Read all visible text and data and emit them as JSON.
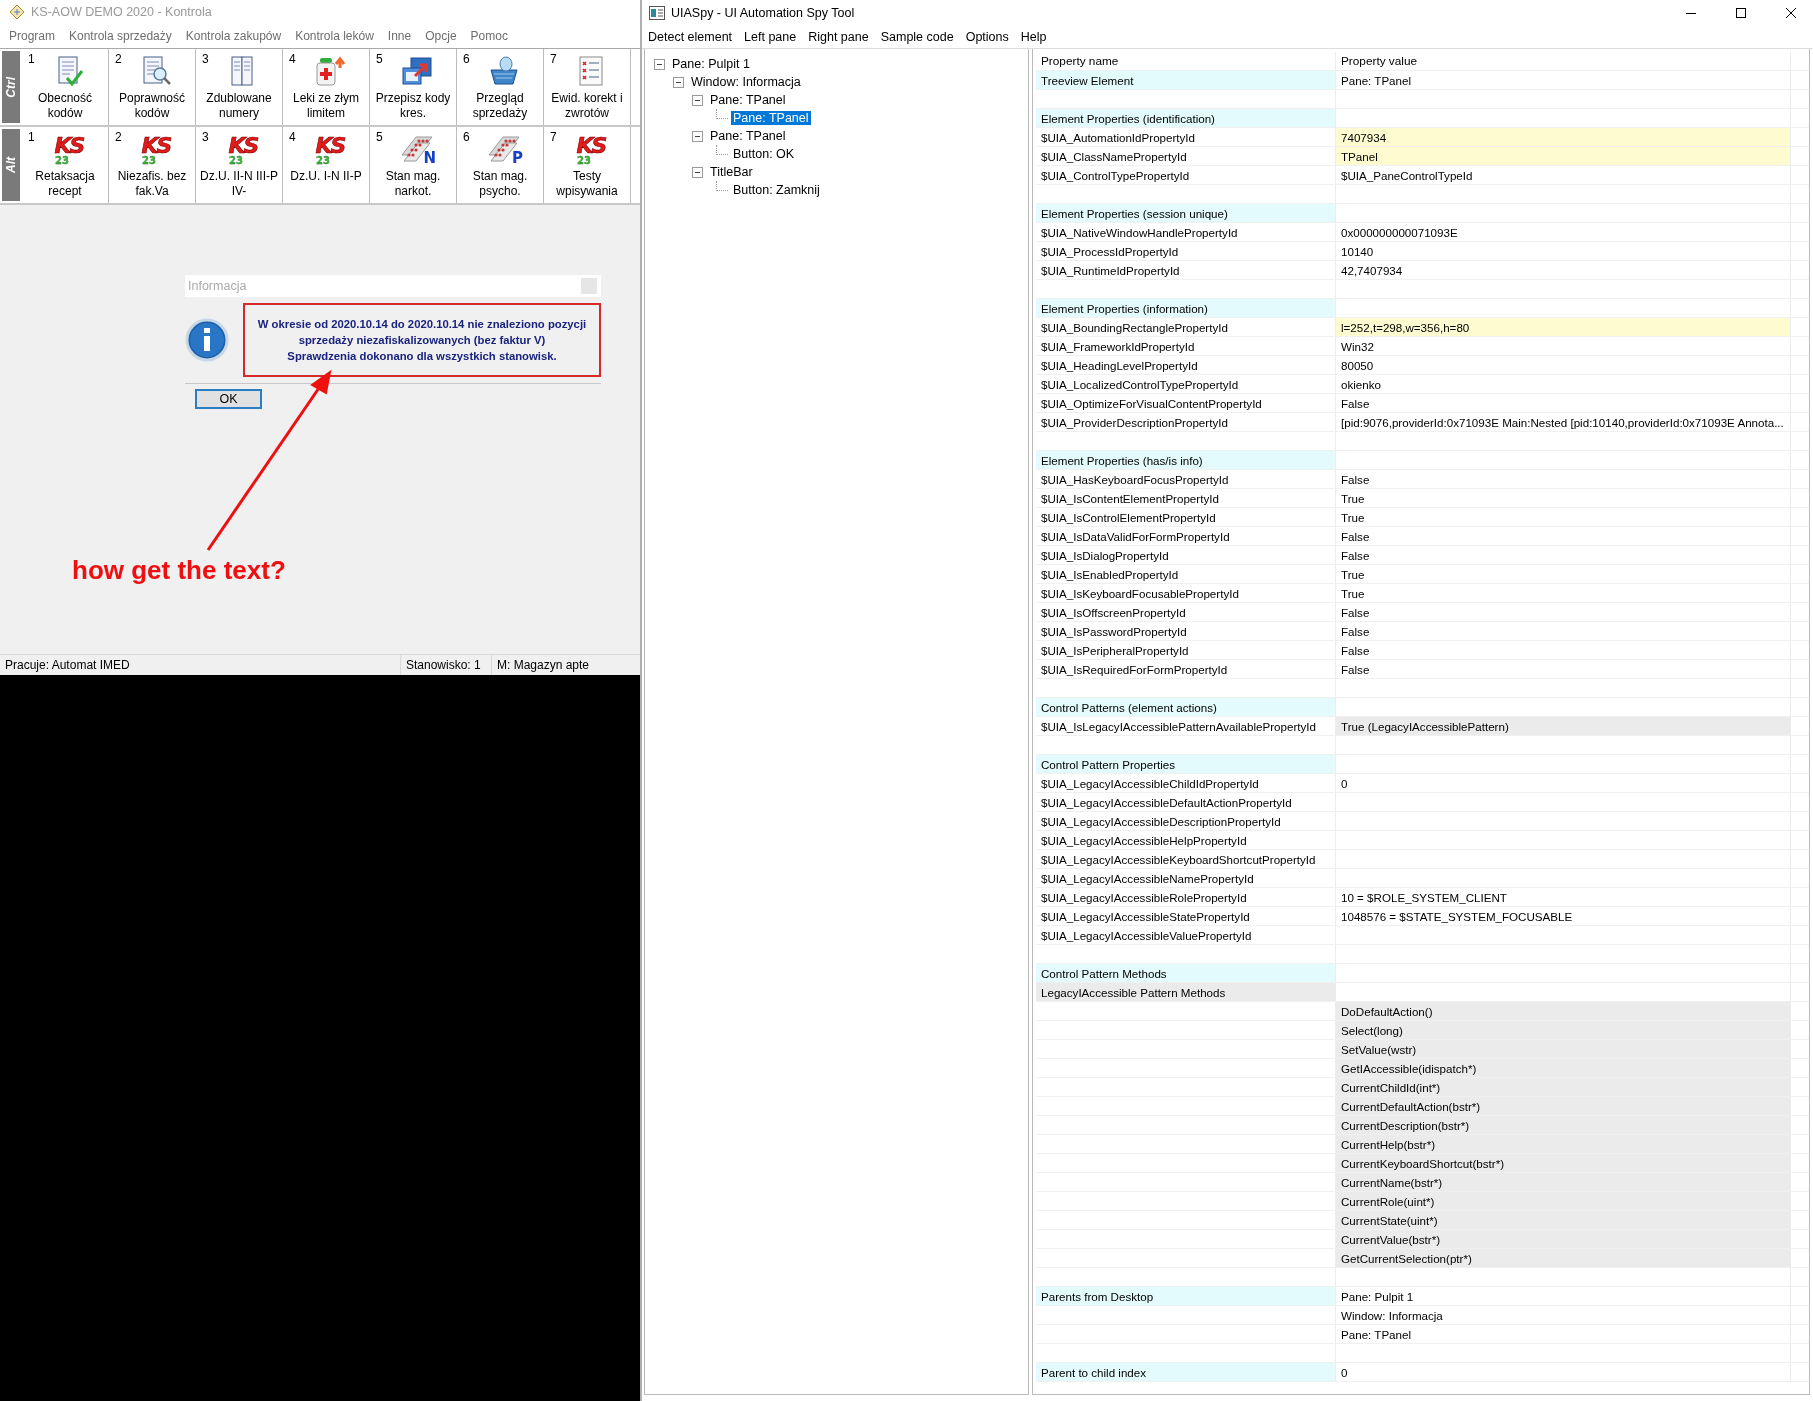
{
  "left_window": {
    "title": "KS-AOW DEMO 2020 - Kontrola",
    "menu": [
      "Program",
      "Kontrola sprzedaży",
      "Kontrola zakupów",
      "Kontrola leków",
      "Inne",
      "Opcje",
      "Pomoc"
    ],
    "toolbar_rows": [
      {
        "modifier": "Ctrl",
        "buttons": [
          {
            "number": "1",
            "label": "Obecność kodów",
            "kind": "check-doc"
          },
          {
            "number": "2",
            "label": "Poprawność kodów",
            "kind": "search-doc"
          },
          {
            "number": "3",
            "label": "Zdublowane numery",
            "kind": "double-doc"
          },
          {
            "number": "4",
            "label": "Leki ze złym limitem",
            "kind": "bottle"
          },
          {
            "number": "5",
            "label": "Przepisz kody kres.",
            "kind": "transfer"
          },
          {
            "number": "6",
            "label": "Przegląd sprzedaży",
            "kind": "basket"
          },
          {
            "number": "7",
            "label": "Ewid. korekt i zwrotów",
            "kind": "list-x"
          }
        ]
      },
      {
        "modifier": "Alt",
        "buttons": [
          {
            "number": "1",
            "label": "Retaksacja recept",
            "kind": "logo",
            "logo": "KS",
            "logo_number": "23"
          },
          {
            "number": "2",
            "label": "Niezafis. bez fak.Va",
            "kind": "logo",
            "logo": "KS",
            "logo_number": "23"
          },
          {
            "number": "3",
            "label": "Dz.U. II-N III-P IV-",
            "kind": "logo",
            "logo": "KS",
            "logo_number": "23"
          },
          {
            "number": "4",
            "label": "Dz.U. I-N II-P",
            "kind": "logo",
            "logo": "KS",
            "logo_number": "23"
          },
          {
            "number": "5",
            "label": "Stan mag. narkot.",
            "kind": "pills",
            "letter": "N"
          },
          {
            "number": "6",
            "label": "Stan mag. psycho.",
            "kind": "pills",
            "letter": "P"
          },
          {
            "number": "7",
            "label": "Testy wpisywania",
            "kind": "logo",
            "logo": "KS",
            "logo_number": "23"
          }
        ]
      }
    ],
    "dialog": {
      "title": "Informacja",
      "message_lines": [
        "W okresie od 2020.10.14 do 2020.10.14 nie znaleziono pozycji",
        "sprzedaży niezafiskalizowanych (bez faktur V)",
        "Sprawdzenia dokonano dla wszystkich stanowisk."
      ],
      "button": "OK"
    },
    "annotation": {
      "text": "how get the text?"
    },
    "status_bar": [
      "Pracuje: Automat IMED",
      "Stanowisko: 1",
      "M: Magazyn apte"
    ]
  },
  "spy_window": {
    "title": "UIASpy - UI Automation Spy Tool",
    "menu": [
      "Detect element",
      "Left pane",
      "Right pane",
      "Sample code",
      "Options",
      "Help"
    ],
    "tree": [
      {
        "label": "Pane: Pulpit 1",
        "selected": false,
        "expanded": true,
        "children": [
          {
            "label": "Window: Informacja",
            "selected": false,
            "expanded": true,
            "children": [
              {
                "label": "Pane: TPanel",
                "selected": false,
                "expanded": true,
                "children": [
                  {
                    "label": "Pane: TPanel",
                    "selected": true
                  }
                ]
              },
              {
                "label": "Pane: TPanel",
                "selected": false,
                "expanded": true,
                "children": [
                  {
                    "label": "Button: OK",
                    "selected": false
                  }
                ]
              },
              {
                "label": "TitleBar",
                "selected": false,
                "expanded": true,
                "children": [
                  {
                    "label": "Button: Zamknij",
                    "selected": false
                  }
                ]
              }
            ]
          }
        ]
      }
    ],
    "properties": {
      "columns": [
        "Property name",
        "Property value"
      ],
      "rows": [
        {
          "kind": "section",
          "name": "Treeview Element",
          "value": "Pane: TPanel"
        },
        {
          "kind": "blank"
        },
        {
          "kind": "section",
          "name": "Element Properties (identification)"
        },
        {
          "kind": "property",
          "name": "$UIA_AutomationIdPropertyId",
          "value": "7407934",
          "highlighted": true
        },
        {
          "kind": "property",
          "name": "$UIA_ClassNamePropertyId",
          "value": "TPanel",
          "highlighted": true
        },
        {
          "kind": "property",
          "name": "$UIA_ControlTypePropertyId",
          "value": "$UIA_PaneControlTypeId",
          "highlighted": false
        },
        {
          "kind": "blank"
        },
        {
          "kind": "section",
          "name": "Element Properties (session unique)"
        },
        {
          "kind": "property",
          "name": "$UIA_NativeWindowHandlePropertyId",
          "value": "0x000000000071093E",
          "highlighted": false
        },
        {
          "kind": "property",
          "name": "$UIA_ProcessIdPropertyId",
          "value": "10140",
          "highlighted": false
        },
        {
          "kind": "property",
          "name": "$UIA_RuntimeIdPropertyId",
          "value": "42,7407934",
          "highlighted": false
        },
        {
          "kind": "blank"
        },
        {
          "kind": "section",
          "name": "Element Properties (information)"
        },
        {
          "kind": "property",
          "name": "$UIA_BoundingRectanglePropertyId",
          "value": "l=252,t=298,w=356,h=80",
          "highlighted": true
        },
        {
          "kind": "property",
          "name": "$UIA_FrameworkIdPropertyId",
          "value": "Win32",
          "highlighted": false
        },
        {
          "kind": "property",
          "name": "$UIA_HeadingLevelPropertyId",
          "value": "80050",
          "highlighted": false
        },
        {
          "kind": "property",
          "name": "$UIA_LocalizedControlTypePropertyId",
          "value": "okienko",
          "highlighted": false
        },
        {
          "kind": "property",
          "name": "$UIA_OptimizeForVisualContentPropertyId",
          "value": "False",
          "highlighted": false
        },
        {
          "kind": "property",
          "name": "$UIA_ProviderDescriptionPropertyId",
          "value": "[pid:9076,providerId:0x71093E Main:Nested [pid:10140,providerId:0x71093E Annota...",
          "highlighted": false
        },
        {
          "kind": "blank"
        },
        {
          "kind": "section",
          "name": "Element Properties (has/is info)"
        },
        {
          "kind": "property",
          "name": "$UIA_HasKeyboardFocusPropertyId",
          "value": "False",
          "highlighted": false
        },
        {
          "kind": "property",
          "name": "$UIA_IsContentElementPropertyId",
          "value": "True",
          "highlighted": false
        },
        {
          "kind": "property",
          "name": "$UIA_IsControlElementPropertyId",
          "value": "True",
          "highlighted": false
        },
        {
          "kind": "property",
          "name": "$UIA_IsDataValidForFormPropertyId",
          "value": "False",
          "highlighted": false
        },
        {
          "kind": "property",
          "name": "$UIA_IsDialogPropertyId",
          "value": "False",
          "highlighted": false
        },
        {
          "kind": "property",
          "name": "$UIA_IsEnabledPropertyId",
          "value": "True",
          "highlighted": false
        },
        {
          "kind": "property",
          "name": "$UIA_IsKeyboardFocusablePropertyId",
          "value": "True",
          "highlighted": false
        },
        {
          "kind": "property",
          "name": "$UIA_IsOffscreenPropertyId",
          "value": "False",
          "highlighted": false
        },
        {
          "kind": "property",
          "name": "$UIA_IsPasswordPropertyId",
          "value": "False",
          "highlighted": false
        },
        {
          "kind": "property",
          "name": "$UIA_IsPeripheralPropertyId",
          "value": "False",
          "highlighted": false
        },
        {
          "kind": "property",
          "name": "$UIA_IsRequiredForFormPropertyId",
          "value": "False",
          "highlighted": false
        },
        {
          "kind": "blank"
        },
        {
          "kind": "section",
          "name": "Control Patterns (element actions)"
        },
        {
          "kind": "pattern",
          "name": "$UIA_IsLegacyIAccessiblePatternAvailablePropertyId",
          "value": "True (LegacyIAccessiblePattern)"
        },
        {
          "kind": "blank"
        },
        {
          "kind": "section",
          "name": "Control Pattern Properties"
        },
        {
          "kind": "property",
          "name": "$UIA_LegacyIAccessibleChildIdPropertyId",
          "value": "0",
          "highlighted": false
        },
        {
          "kind": "property",
          "name": "$UIA_LegacyIAccessibleDefaultActionPropertyId",
          "highlighted": false
        },
        {
          "kind": "property",
          "name": "$UIA_LegacyIAccessibleDescriptionPropertyId",
          "highlighted": false
        },
        {
          "kind": "property",
          "name": "$UIA_LegacyIAccessibleHelpPropertyId",
          "highlighted": false
        },
        {
          "kind": "property",
          "name": "$UIA_LegacyIAccessibleKeyboardShortcutPropertyId",
          "highlighted": false
        },
        {
          "kind": "property",
          "name": "$UIA_LegacyIAccessibleNamePropertyId",
          "highlighted": false
        },
        {
          "kind": "property",
          "name": "$UIA_LegacyIAccessibleRolePropertyId",
          "value": "10 = $ROLE_SYSTEM_CLIENT",
          "highlighted": false
        },
        {
          "kind": "property",
          "name": "$UIA_LegacyIAccessibleStatePropertyId",
          "value": "1048576 = $STATE_SYSTEM_FOCUSABLE",
          "highlighted": false
        },
        {
          "kind": "property",
          "name": "$UIA_LegacyIAccessibleValuePropertyId",
          "highlighted": false
        },
        {
          "kind": "blank"
        },
        {
          "kind": "section",
          "name": "Control Pattern Methods"
        },
        {
          "kind": "group",
          "name": "LegacyIAccessible Pattern Methods"
        },
        {
          "kind": "method",
          "value": "DoDefaultAction()"
        },
        {
          "kind": "method",
          "value": "Select(long)"
        },
        {
          "kind": "method",
          "value": "SetValue(wstr)"
        },
        {
          "kind": "method",
          "value": "GetIAccessible(idispatch*)"
        },
        {
          "kind": "method",
          "value": "CurrentChildId(int*)"
        },
        {
          "kind": "method",
          "value": "CurrentDefaultAction(bstr*)"
        },
        {
          "kind": "method",
          "value": "CurrentDescription(bstr*)"
        },
        {
          "kind": "method",
          "value": "CurrentHelp(bstr*)"
        },
        {
          "kind": "method",
          "value": "CurrentKeyboardShortcut(bstr*)"
        },
        {
          "kind": "method",
          "value": "CurrentName(bstr*)"
        },
        {
          "kind": "method",
          "value": "CurrentRole(uint*)"
        },
        {
          "kind": "method",
          "value": "CurrentState(uint*)"
        },
        {
          "kind": "method",
          "value": "CurrentValue(bstr*)"
        },
        {
          "kind": "method",
          "value": "GetCurrentSelection(ptr*)"
        },
        {
          "kind": "blank"
        },
        {
          "kind": "section",
          "name": "Parents from Desktop",
          "value": "Pane: Pulpit 1"
        },
        {
          "kind": "property",
          "value": "Window: Informacja",
          "highlighted": false
        },
        {
          "kind": "property",
          "value": "Pane: TPanel",
          "highlighted": false
        },
        {
          "kind": "blank"
        },
        {
          "kind": "section",
          "name": "Parent to child index",
          "value": "0"
        }
      ]
    }
  }
}
